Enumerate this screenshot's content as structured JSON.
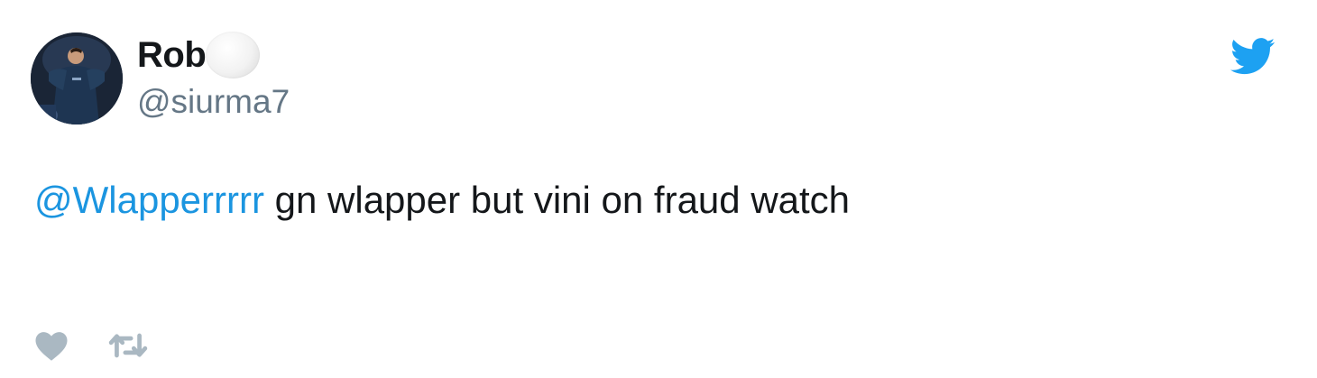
{
  "tweet": {
    "display_name": "Rob",
    "handle": "@siurma7",
    "mention": "@Wlapperrrrr",
    "text": " gn wlapper but vini on fraud watch"
  },
  "icons": {
    "avatar": "profile-photo",
    "name_emoji": "white-circle-emoji",
    "brand": "twitter-bird-icon",
    "like": "heart-icon",
    "retweet": "retweet-icon"
  },
  "colors": {
    "brand": "#1da1f2",
    "mention": "#1b95e0",
    "text": "#14171a",
    "handle": "#657786",
    "action_icon": "#aab8c2"
  }
}
